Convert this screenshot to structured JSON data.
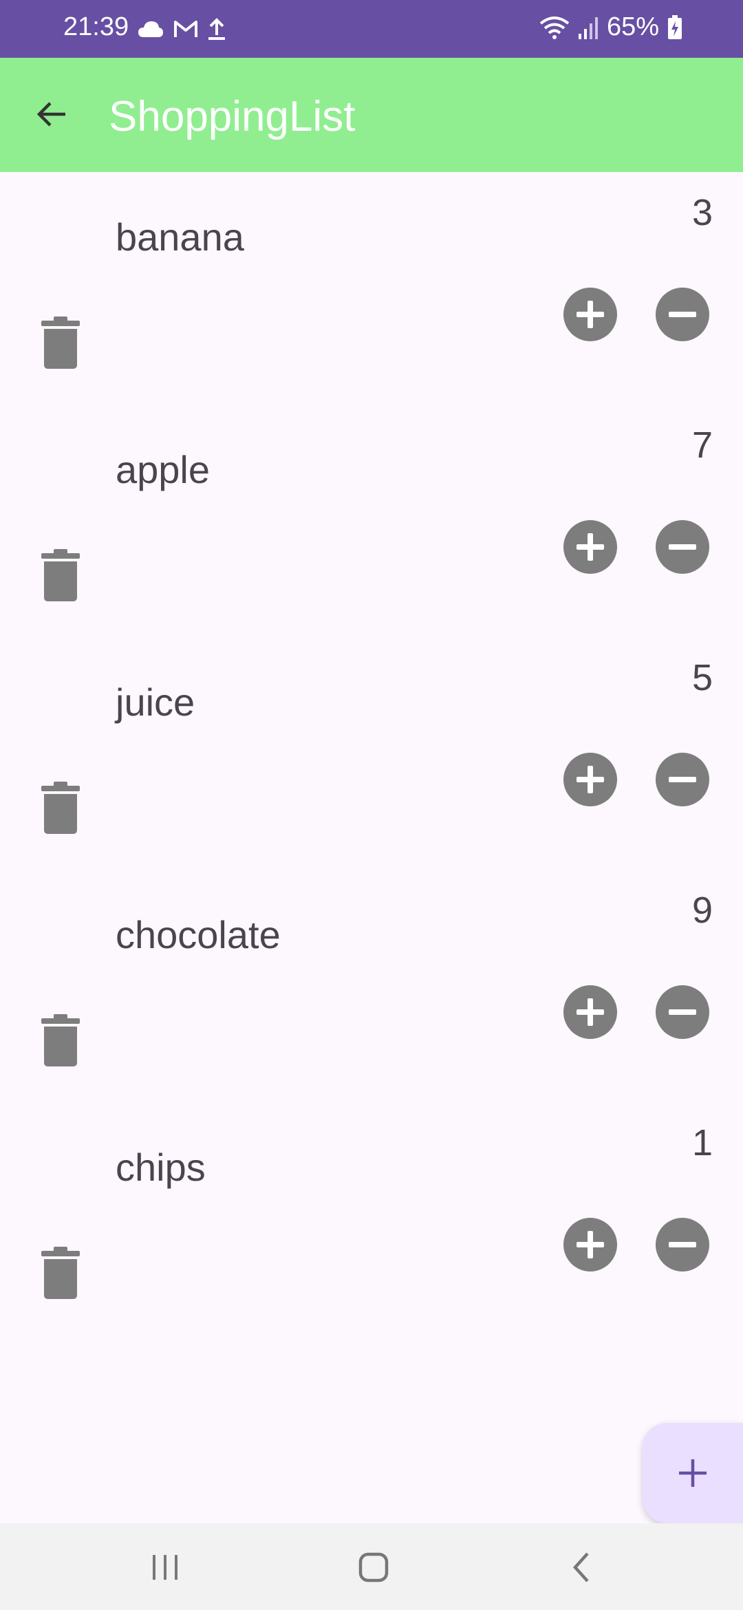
{
  "status_bar": {
    "time": "21:39",
    "battery": "65%",
    "icons": [
      "cloud-icon",
      "gmail-icon",
      "upload-icon",
      "wifi-icon",
      "signal-icon",
      "battery-charging-icon"
    ]
  },
  "app_bar": {
    "title": "ShoppingList",
    "back_icon": "arrow-back-icon",
    "background": "#90ee90"
  },
  "items": [
    {
      "name": "banana",
      "qty": "3"
    },
    {
      "name": "apple",
      "qty": "7"
    },
    {
      "name": "juice",
      "qty": "5"
    },
    {
      "name": "chocolate",
      "qty": "9"
    },
    {
      "name": "chips",
      "qty": "1"
    }
  ],
  "fab": {
    "icon": "add-icon",
    "color": "#eadfff"
  },
  "nav_bar": {
    "icons": [
      "recents-icon",
      "home-icon",
      "back-icon"
    ]
  },
  "colors": {
    "status_bar": "#674fa3",
    "page_background": "#fdf7fe",
    "button_gray": "#7d7d7d"
  }
}
